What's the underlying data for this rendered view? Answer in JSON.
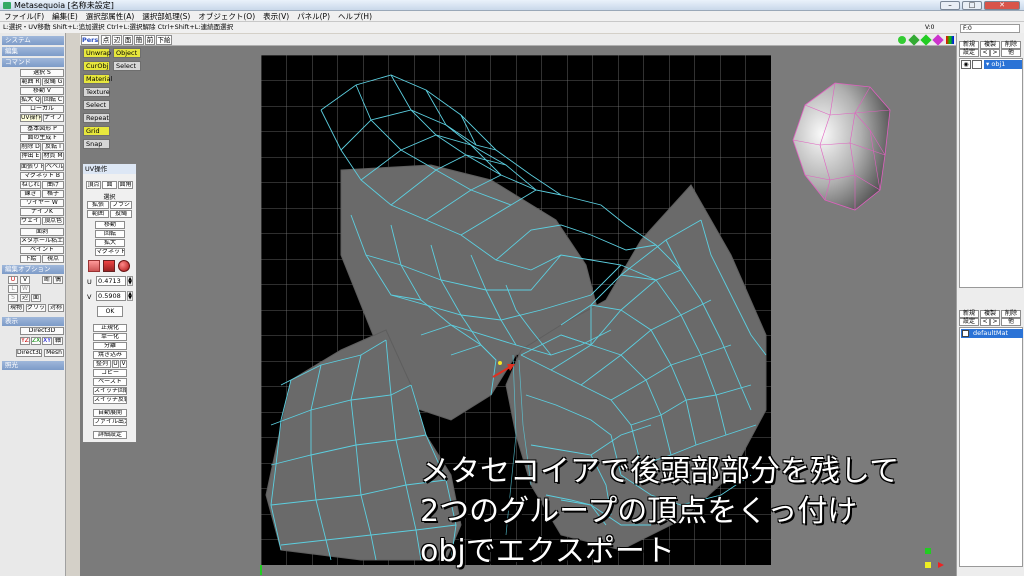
{
  "titlebar": {
    "title": "Metasequoia [名称未設定]",
    "minimize": "–",
    "maximize": "□",
    "close": "✕"
  },
  "menu": [
    "ファイル(F)",
    "編集(E)",
    "選択部属性(A)",
    "選択部処理(S)",
    "オブジェクト(O)",
    "表示(V)",
    "パネル(P)",
    "ヘルプ(H)"
  ],
  "hint": "L:選択・UV移動  Shift+L:追加選択  Ctrl+L:選択解除  Ctrl+Shift+L:連続面選択",
  "counters": {
    "v": "V:0",
    "f": "F:0"
  },
  "left": {
    "system": "システム",
    "edit": "編集",
    "command": "コマンド",
    "cmds": [
      "選択 S",
      "範囲 R",
      "投縄 G",
      "移動 V",
      "拡大 Q",
      "回転 C",
      "ローカル",
      "UV操作 U",
      "ナイフ K",
      "基本図形 P",
      "面の生成 F",
      "削除 D",
      "反転 I",
      "押出 E",
      "材質 M",
      "面張り H",
      "ベベル",
      "マグネット B",
      "ねじれ",
      "曲げ",
      "錬き",
      "格子",
      "ワイヤー W",
      "ナイフK",
      "ウェイト",
      "頂点色",
      "面剥",
      "メタボール粘土",
      "ペイント",
      "下絵",
      "視点"
    ],
    "editopt": "編集オプション",
    "opts": [
      "U",
      "V",
      "断",
      "偶",
      "L",
      "W",
      "S",
      "辺",
      "面",
      "現物",
      "グリッド",
      "対称"
    ],
    "display": "表示",
    "disp": [
      "Direct3D",
      "YZ",
      "ZX",
      "XY",
      "軸",
      "Direct3D",
      "Mesh"
    ],
    "light": "照光"
  },
  "viewtool": {
    "pers": "Pers",
    "b1": "点",
    "b2": "辺",
    "b3": "面",
    "b4": "簡",
    "b5": "前",
    "b6": "下絵"
  },
  "modes": {
    "unwrap": "Unwrap",
    "object": "Object",
    "curobj": "CurObj",
    "select": "Select",
    "material": "Material",
    "texture": "Texture",
    "select2": "Select",
    "repeat": "Repeat",
    "grid": "Grid",
    "snap": "Snap"
  },
  "uvpanel": {
    "title": "UV操作",
    "tabs": [
      "頂点",
      "面",
      "面角"
    ],
    "select_hdr": "選択",
    "sel": [
      "拡張",
      "ブラシ",
      "範囲",
      "投縄"
    ],
    "ops": [
      "移動",
      "回転",
      "拡大",
      "マグネット"
    ],
    "u_label": "U",
    "u_value": "0.4713",
    "v_label": "V",
    "v_value": "0.5908",
    "ok": "OK",
    "tools": [
      "正規化",
      "単一化",
      "分離",
      "焼き込み",
      "整列",
      "U",
      "V",
      "コピー",
      "ペースト",
      "スイッチ回転",
      "スイッチ反転",
      "自動展開",
      "ファイル出力",
      "詳細設定"
    ]
  },
  "right": {
    "obj_btns": [
      "新規",
      "複製",
      "削除",
      "設定",
      "<",
      ">",
      "他"
    ],
    "object_name": "obj1",
    "mat_btns": [
      "新規",
      "複製",
      "削除",
      "設定",
      "<",
      ">",
      "他"
    ],
    "material_name": "defaultMat"
  },
  "caption": [
    "メタセコイアで後頭部部分を残して",
    "2つのグループの頂点をくっ付け",
    "objでエクスポート"
  ],
  "colors": {
    "accent": "#e7e73c",
    "wire": "#68c8d8",
    "selection": "#2b73d6",
    "arrow": "#e03020"
  }
}
